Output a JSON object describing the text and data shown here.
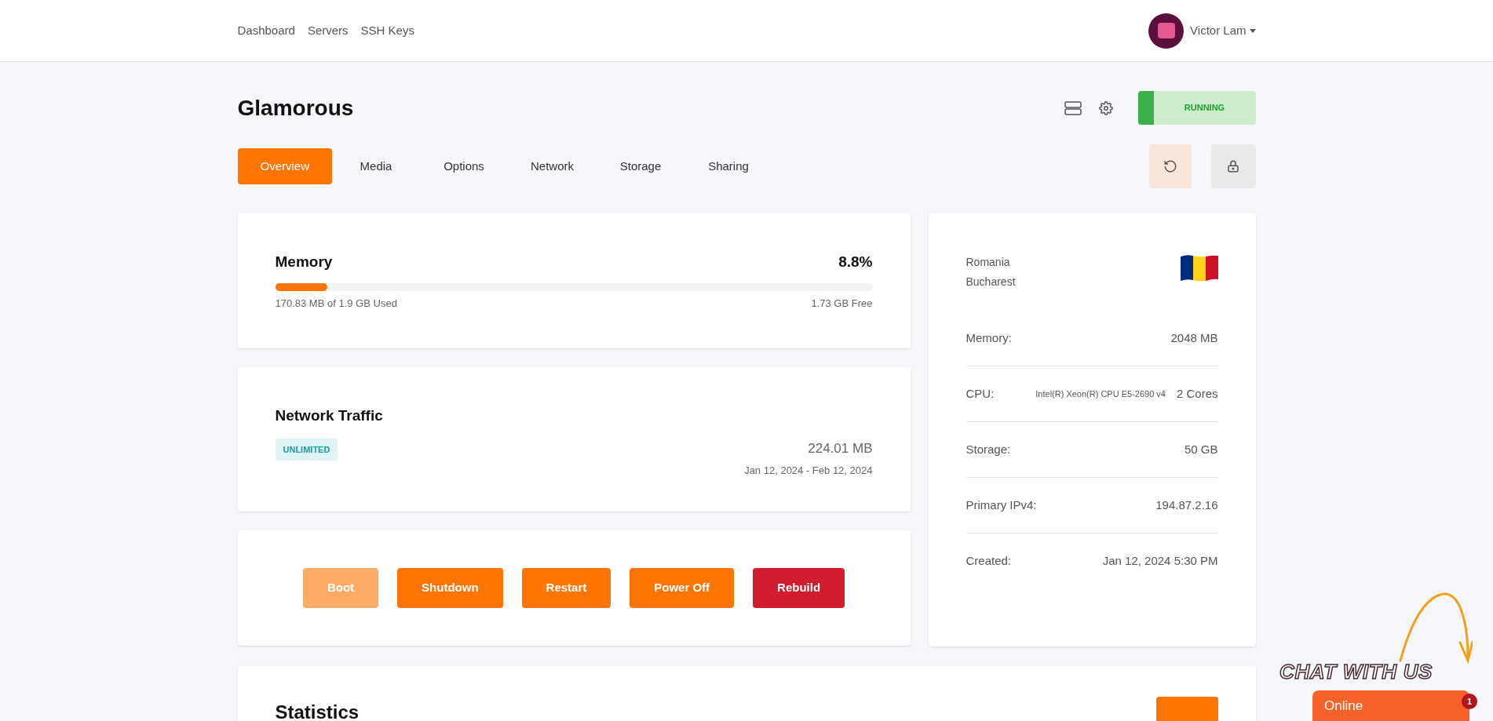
{
  "nav": {
    "links": [
      "Dashboard",
      "Servers",
      "SSH Keys"
    ],
    "user": "Victor Lam"
  },
  "server": {
    "name": "Glamorous",
    "status": "RUNNING"
  },
  "tabs": [
    {
      "label": "Overview",
      "selected": true
    },
    {
      "label": "Media",
      "selected": false
    },
    {
      "label": "Options",
      "selected": false
    },
    {
      "label": "Network",
      "selected": false
    },
    {
      "label": "Storage",
      "selected": false
    },
    {
      "label": "Sharing",
      "selected": false
    }
  ],
  "memory": {
    "title": "Memory",
    "percent": "8.8%",
    "level": 0.088,
    "used": "170.83 MB of 1.9 GB Used",
    "free": "1.73 GB Free"
  },
  "network_traffic": {
    "title": "Network Traffic",
    "badge": "UNLIMITED",
    "amount": "224.01 MB",
    "period": "Jan 12, 2024 - Feb 12, 2024"
  },
  "actions": [
    {
      "label": "Boot",
      "kind": "primary",
      "disabled": true
    },
    {
      "label": "Shutdown",
      "kind": "primary",
      "disabled": false
    },
    {
      "label": "Restart",
      "kind": "primary",
      "disabled": false
    },
    {
      "label": "Power Off",
      "kind": "primary",
      "disabled": false
    },
    {
      "label": "Rebuild",
      "kind": "danger",
      "disabled": false
    }
  ],
  "location": {
    "country": "Romania",
    "city": "Bucharest"
  },
  "specs": [
    {
      "label": "Memory:",
      "value": "2048 MB"
    },
    {
      "label": "CPU:",
      "detail": "Intel(R) Xeon(R) CPU E5-2690 v4",
      "value": "2 Cores"
    },
    {
      "label": "Storage:",
      "value": "50 GB"
    },
    {
      "label": "Primary IPv4:",
      "value": "194.87.2.16"
    },
    {
      "label": "Created:",
      "value": "Jan 12, 2024 5:30 PM"
    }
  ],
  "statistics": {
    "title": "Statistics"
  },
  "chat": {
    "headline": "CHAT WITH US",
    "status": "Online",
    "unread": "1"
  }
}
